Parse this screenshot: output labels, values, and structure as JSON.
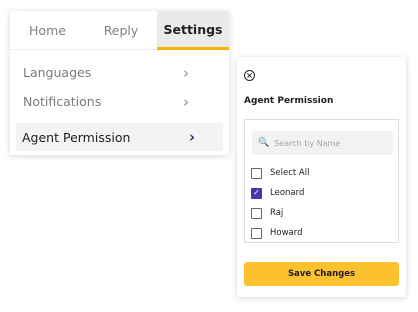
{
  "tabs": [
    {
      "label": "Home"
    },
    {
      "label": "Reply"
    },
    {
      "label": "Settings"
    }
  ],
  "menu": {
    "items": [
      {
        "label": "Languages",
        "chevron": "›"
      },
      {
        "label": "Notifications",
        "chevron": "›"
      },
      {
        "label": "Agent Permission",
        "chevron": "›"
      }
    ],
    "active_index": 2
  },
  "panel": {
    "close_icon": "⊗",
    "title": "Agent Permission",
    "search_placeholder": "Search by Name",
    "search_value": "",
    "options": [
      {
        "label": "Select All",
        "checked": false
      },
      {
        "label": "Leonard",
        "checked": true
      },
      {
        "label": "Raj",
        "checked": false
      },
      {
        "label": "Howard",
        "checked": false
      }
    ],
    "save_label": "Save Changes"
  },
  "colors": {
    "accent_yellow": "#fcc22e",
    "tab_underline": "#f7b500",
    "checkbox_checked": "#4a35a8"
  }
}
